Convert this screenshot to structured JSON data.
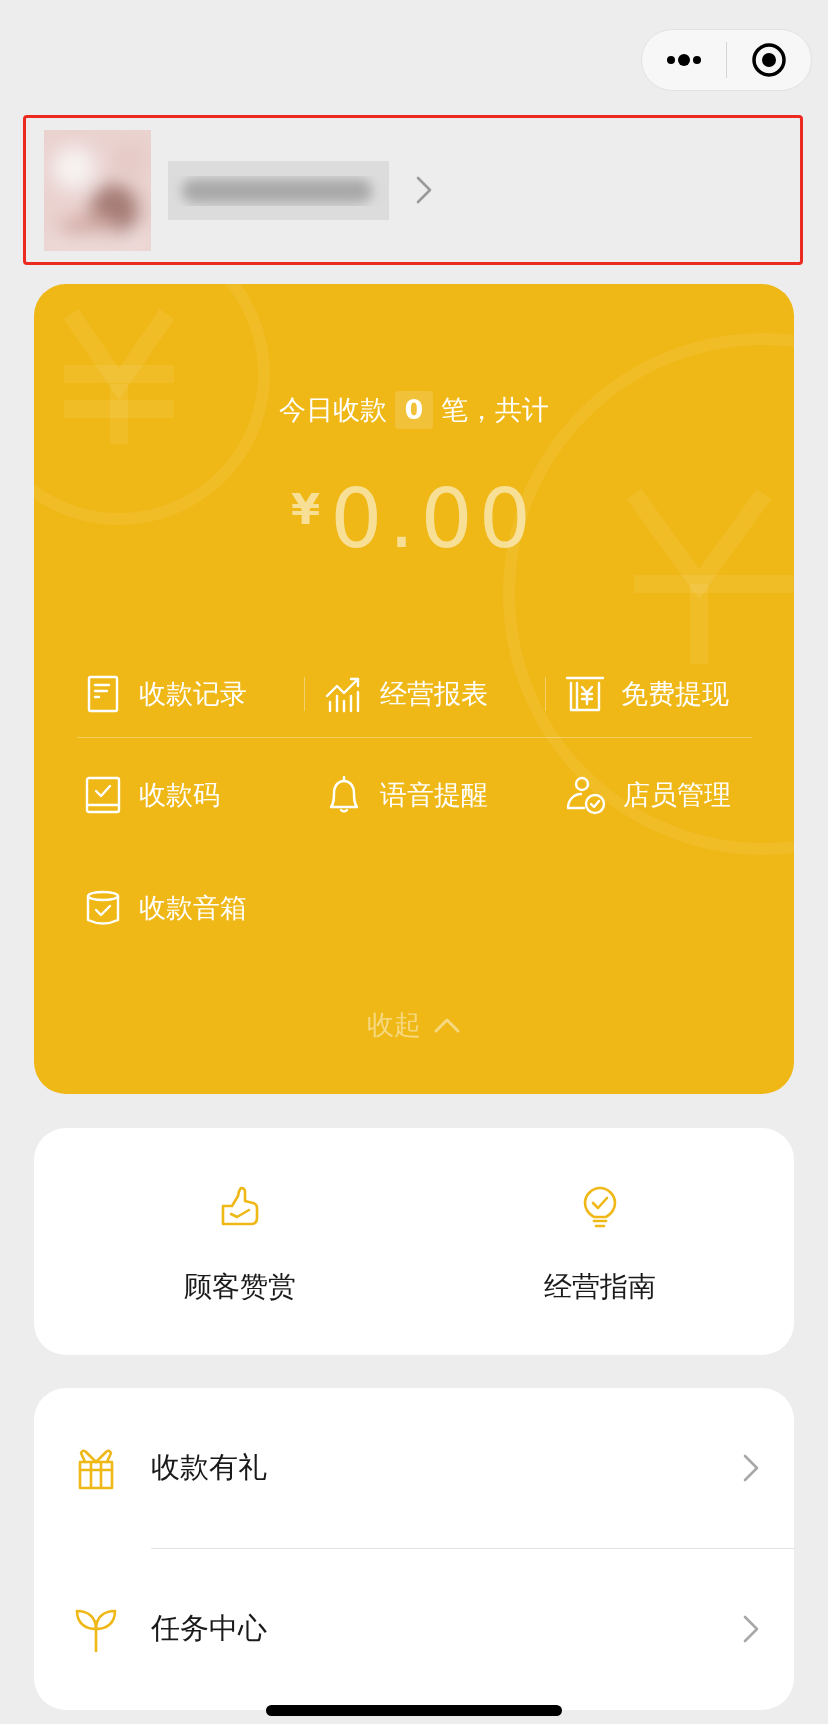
{
  "profile": {
    "highlighted": true
  },
  "summary": {
    "prefix": "今日收款",
    "count": "0",
    "suffix": "笔，共计",
    "currency": "¥",
    "amount": "0.00"
  },
  "primary_actions": [
    {
      "label": "收款记录"
    },
    {
      "label": "经营报表"
    },
    {
      "label": "免费提现"
    }
  ],
  "more_actions": [
    {
      "label": "收款码"
    },
    {
      "label": "语音提醒"
    },
    {
      "label": "店员管理"
    },
    {
      "label": "收款音箱"
    }
  ],
  "collapse": {
    "label": "收起"
  },
  "shortcuts": [
    {
      "label": "顾客赞赏"
    },
    {
      "label": "经营指南"
    }
  ],
  "menu": [
    {
      "label": "收款有礼"
    },
    {
      "label": "任务中心"
    }
  ]
}
